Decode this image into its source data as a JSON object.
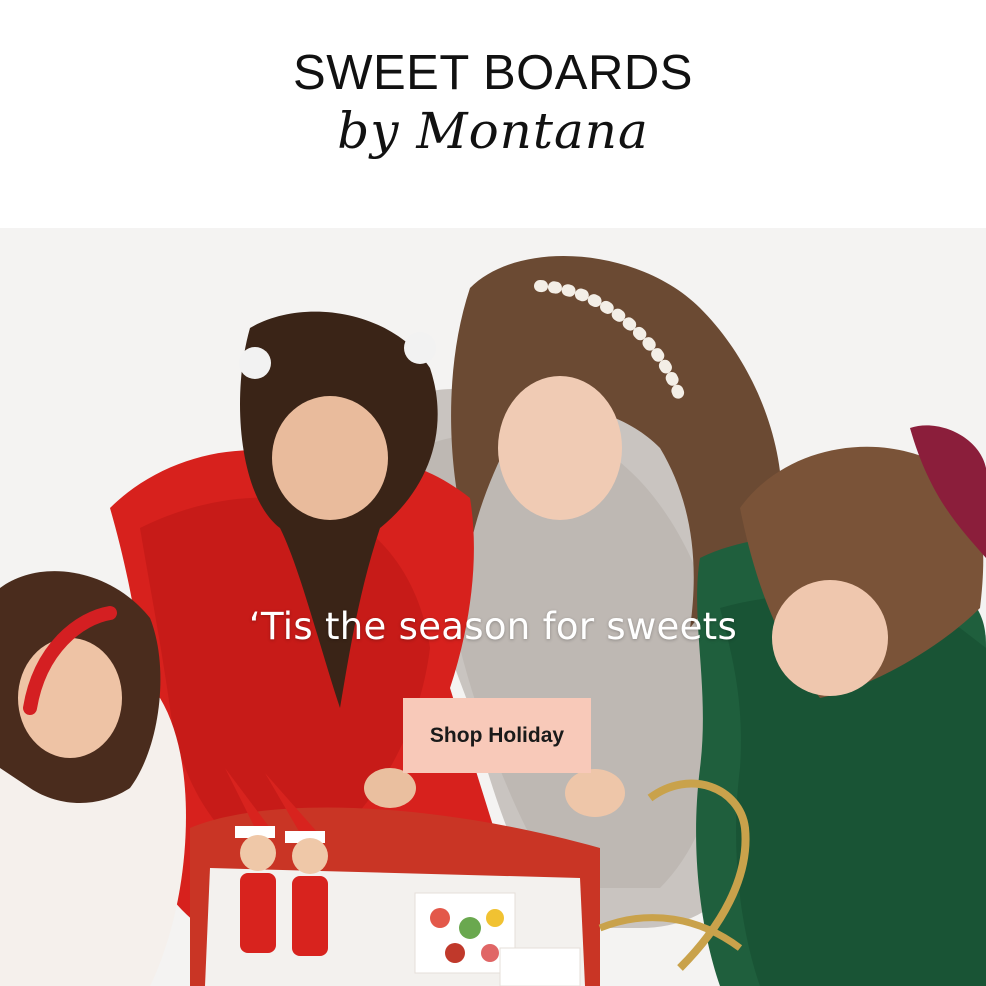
{
  "header": {
    "logo": {
      "line1": "SWEET BOARDS",
      "line2": "by Montana"
    }
  },
  "hero": {
    "headline": "‘Tis the season for sweets",
    "cta_label": "Shop Holiday",
    "image_alt": "Girls in holiday dresses gathered around a red sleigh with elves and a candy box",
    "colors": {
      "cta_background": "#f8c9b9",
      "headline_text": "#ffffff"
    }
  }
}
